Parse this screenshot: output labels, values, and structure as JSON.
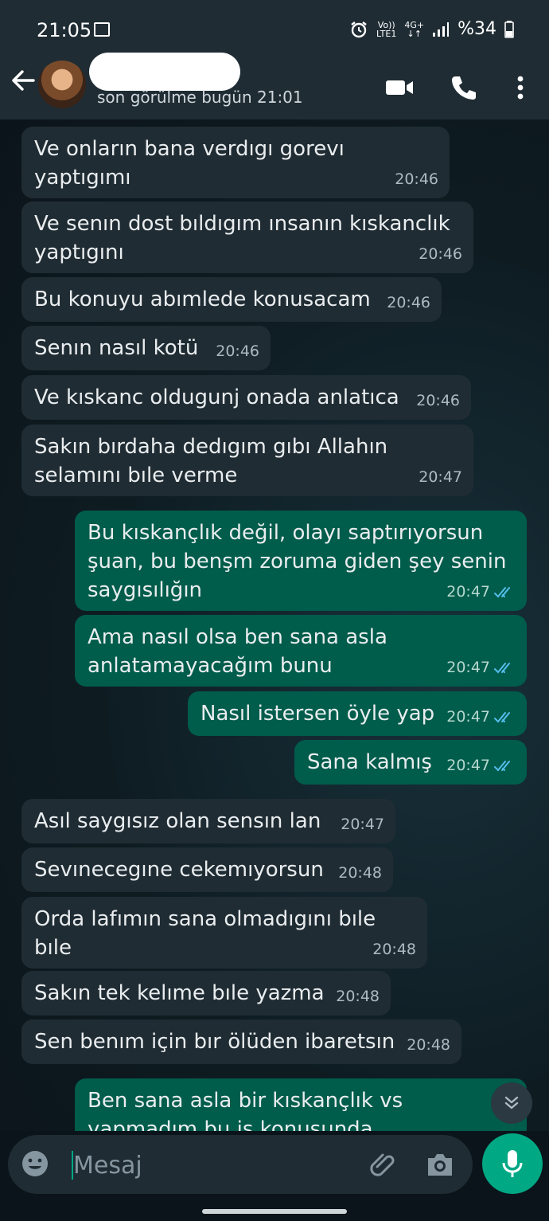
{
  "status_bar": {
    "time": "21:05",
    "signal_top": "Vo))",
    "signal_bottom": "LTE1",
    "network_top": "4G+",
    "network_bottom": "↓↑",
    "battery": "%34"
  },
  "header": {
    "last_seen": "son görülme bugün 21:01"
  },
  "messages": [
    {
      "dir": "in",
      "text": "Ve onların bana verdıgı gorevı yaptıgımı",
      "time": "20:46"
    },
    {
      "dir": "in",
      "text": "Ve senın dost bıldıgım ınsanın kıskanclık\nyaptıgını",
      "time": "20:46"
    },
    {
      "dir": "in",
      "text": "Bu konuyu abımlede konusacam",
      "time": "20:46"
    },
    {
      "dir": "in",
      "text": "Senın nasıl kotü",
      "time": "20:46"
    },
    {
      "dir": "in",
      "text": "Ve kıskanc oldugunj onada anlatıca",
      "time": "20:46"
    },
    {
      "dir": "in",
      "text": "Sakın bırdaha dedıgım gıbı Allahın\nselamını bıle verme",
      "time": "20:47"
    },
    {
      "dir": "out",
      "text": "Bu kıskançlık değil, olayı saptırıyorsun\nşuan, bu benşm zoruma giden şey senin\nsaygısılığın",
      "time": "20:47"
    },
    {
      "dir": "out",
      "text": "Ama nasıl olsa ben sana asla\nanlatamayacağım bunu",
      "time": "20:47"
    },
    {
      "dir": "out",
      "text": "Nasıl istersen öyle yap",
      "time": "20:47"
    },
    {
      "dir": "out",
      "text": "Sana kalmış",
      "time": "20:47"
    },
    {
      "dir": "in",
      "text": "Asıl saygısız olan sensın lan",
      "time": "20:47"
    },
    {
      "dir": "in",
      "text": "Sevınecegıne cekemıyorsun",
      "time": "20:48"
    },
    {
      "dir": "in",
      "text": "Orda lafımın sana olmadıgını bıle bıle",
      "time": "20:48"
    },
    {
      "dir": "in",
      "text": "Sakın tek kelıme bıle yazma",
      "time": "20:48"
    },
    {
      "dir": "in",
      "text": "Sen benım için bır ölüden ibaretsın",
      "time": "20:48"
    },
    {
      "dir": "out",
      "text": "Ben sana asla bir kıskançlık vs\nyapmadım bu iş konusunda",
      "time": ""
    }
  ],
  "composer": {
    "placeholder": "Mesaj"
  },
  "colors": {
    "incoming_bubble": "#202c33",
    "outgoing_bubble": "#005c4b",
    "accent": "#00a884",
    "read_ticks": "#53bdeb"
  }
}
